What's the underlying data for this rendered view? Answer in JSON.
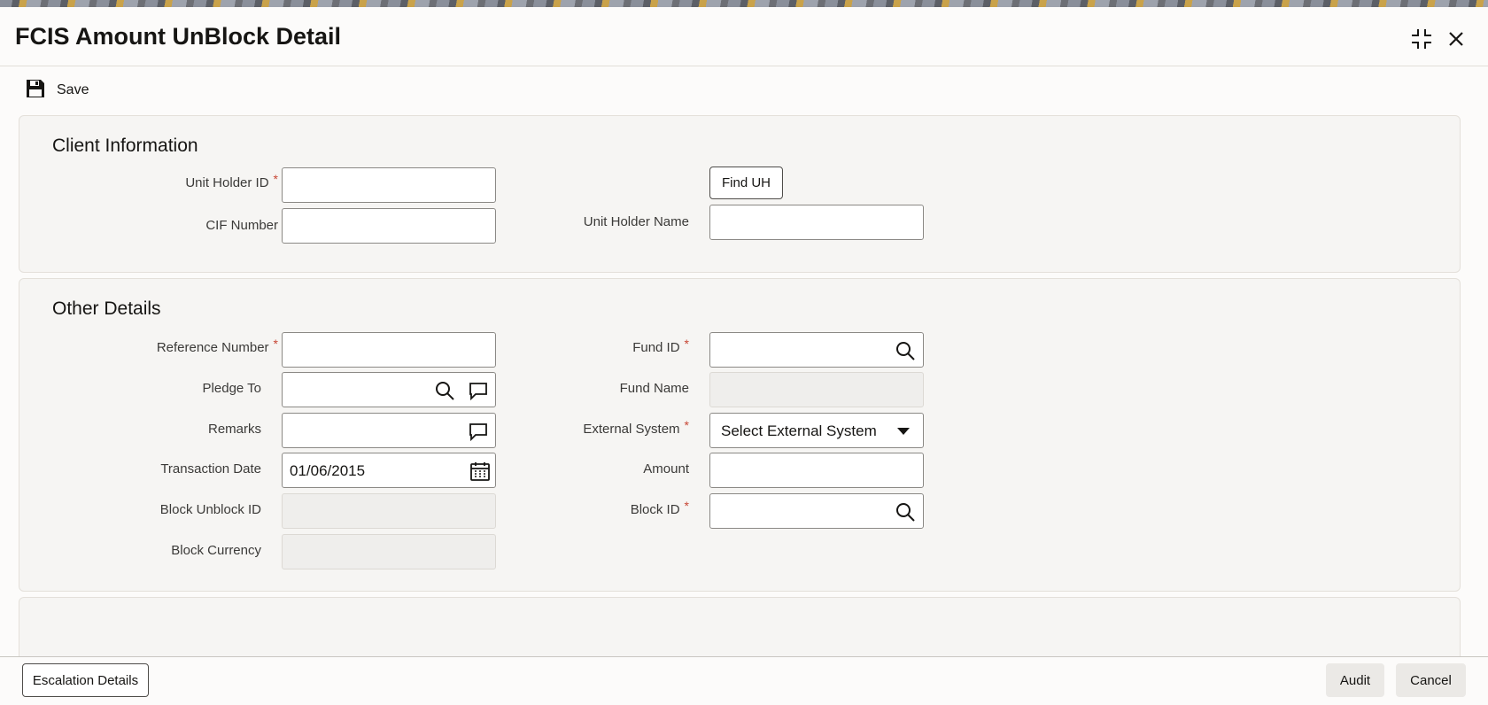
{
  "window": {
    "title": "FCIS Amount UnBlock Detail"
  },
  "toolbar": {
    "save_label": "Save"
  },
  "client_info": {
    "title": "Client Information",
    "unit_holder_id_label": "Unit Holder ID",
    "unit_holder_id_value": "",
    "cif_number_label": "CIF Number",
    "cif_number_value": "",
    "find_uh_label": "Find UH",
    "unit_holder_name_label": "Unit Holder Name",
    "unit_holder_name_value": ""
  },
  "other_details": {
    "title": "Other Details",
    "reference_number_label": "Reference Number",
    "pledge_to_label": "Pledge To",
    "remarks_label": "Remarks",
    "transaction_date_label": "Transaction Date",
    "transaction_date_value": "01/06/2015",
    "block_unblock_id_label": "Block Unblock ID",
    "block_currency_label": "Block Currency",
    "fund_id_label": "Fund ID",
    "fund_name_label": "Fund Name",
    "external_system_label": "External System",
    "external_system_value": "Select External System",
    "amount_label": "Amount",
    "block_id_label": "Block ID"
  },
  "footer": {
    "escalation_label": "Escalation Details",
    "audit_label": "Audit",
    "cancel_label": "Cancel"
  },
  "required_mark": "*",
  "icons": {
    "save": "save-icon",
    "maximize": "maximize-icon",
    "close": "close-icon",
    "search": "search-icon",
    "comment": "comment-icon",
    "calendar": "calendar-icon"
  },
  "colors": {
    "required": "#c74634",
    "accent": "#161513"
  }
}
